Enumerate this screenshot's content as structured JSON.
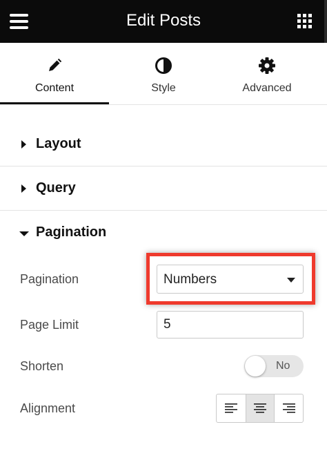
{
  "header": {
    "title": "Edit Posts",
    "menu_icon": "hamburger-menu-icon",
    "apps_icon": "grid-apps-icon"
  },
  "tabs": [
    {
      "label": "Content",
      "icon": "pencil-icon",
      "active": true
    },
    {
      "label": "Style",
      "icon": "half-circle-contrast-icon",
      "active": false
    },
    {
      "label": "Advanced",
      "icon": "gear-icon",
      "active": false
    }
  ],
  "sections": [
    {
      "title": "Layout",
      "expanded": false
    },
    {
      "title": "Query",
      "expanded": false
    },
    {
      "title": "Pagination",
      "expanded": true
    }
  ],
  "pagination": {
    "pagination_label": "Pagination",
    "pagination_value": "Numbers",
    "page_limit_label": "Page Limit",
    "page_limit_value": "5",
    "shorten_label": "Shorten",
    "shorten_toggle_text": "No",
    "shorten_enabled": false,
    "alignment_label": "Alignment",
    "alignment_options": [
      "align-left-icon",
      "align-center-icon",
      "align-right-icon"
    ],
    "alignment_selected": "center"
  },
  "colors": {
    "header_bg": "#0b0b0b",
    "highlight": "#ef3a2d",
    "active_tab_underline": "#111111"
  }
}
